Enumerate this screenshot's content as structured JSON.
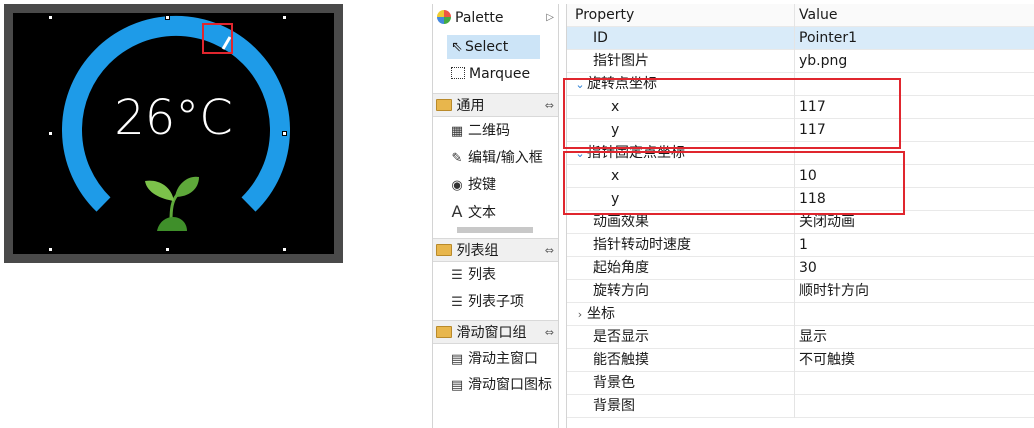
{
  "preview": {
    "temperature": "26°C",
    "colors": {
      "gauge_arc": "#1e9be8",
      "screen_bg": "#000000",
      "leaf": "#5ea83a",
      "selection": "#e0262e"
    },
    "icons": [
      "gauge-arc",
      "pointer-needle",
      "plant-sprout-icon"
    ]
  },
  "palette": {
    "title": "Palette",
    "tools": [
      {
        "label": "Select",
        "icon": "arrow-pointer-icon",
        "selected": true
      },
      {
        "label": "Marquee",
        "icon": "marquee-icon"
      }
    ],
    "groups": [
      {
        "label": "通用",
        "items": [
          {
            "label": "二维码",
            "icon": "qr-code-icon"
          },
          {
            "label": "编辑/输入框",
            "icon": "pencil-icon"
          },
          {
            "label": "按键",
            "icon": "radio-button-icon"
          },
          {
            "label": "文本",
            "icon": "text-a-icon"
          }
        ]
      },
      {
        "label": "列表组",
        "items": [
          {
            "label": "列表",
            "icon": "list-icon"
          },
          {
            "label": "列表子项",
            "icon": "list-icon"
          }
        ]
      },
      {
        "label": "滑动窗口组",
        "items": [
          {
            "label": "滑动主窗口",
            "icon": "grid-window-icon"
          },
          {
            "label": "滑动窗口图标",
            "icon": "grid-window-icon"
          }
        ]
      }
    ]
  },
  "properties": {
    "header": {
      "property": "Property",
      "value": "Value"
    },
    "rows": [
      {
        "name": "ID",
        "value": "Pointer1",
        "highlight": true
      },
      {
        "name": "指针图片",
        "value": "yb.png"
      },
      {
        "name": "旋转点坐标",
        "value": "",
        "expanded": true,
        "category": true
      },
      {
        "name": "x",
        "value": "117",
        "child": true
      },
      {
        "name": "y",
        "value": "117",
        "child": true
      },
      {
        "name": "指针固定点坐标",
        "value": "",
        "expanded": true,
        "category": true
      },
      {
        "name": "x",
        "value": "10",
        "child": true
      },
      {
        "name": "y",
        "value": "118",
        "child": true
      },
      {
        "name": "动画效果",
        "value": "关闭动画"
      },
      {
        "name": "指针转动时速度",
        "value": "1"
      },
      {
        "name": "起始角度",
        "value": "30"
      },
      {
        "name": "旋转方向",
        "value": "顺时针方向"
      },
      {
        "name": "坐标",
        "value": "",
        "collapsed": true
      },
      {
        "name": "是否显示",
        "value": "显示"
      },
      {
        "name": "能否触摸",
        "value": "不可触摸"
      },
      {
        "name": "背景色",
        "value": ""
      },
      {
        "name": "背景图",
        "value": ""
      }
    ]
  }
}
